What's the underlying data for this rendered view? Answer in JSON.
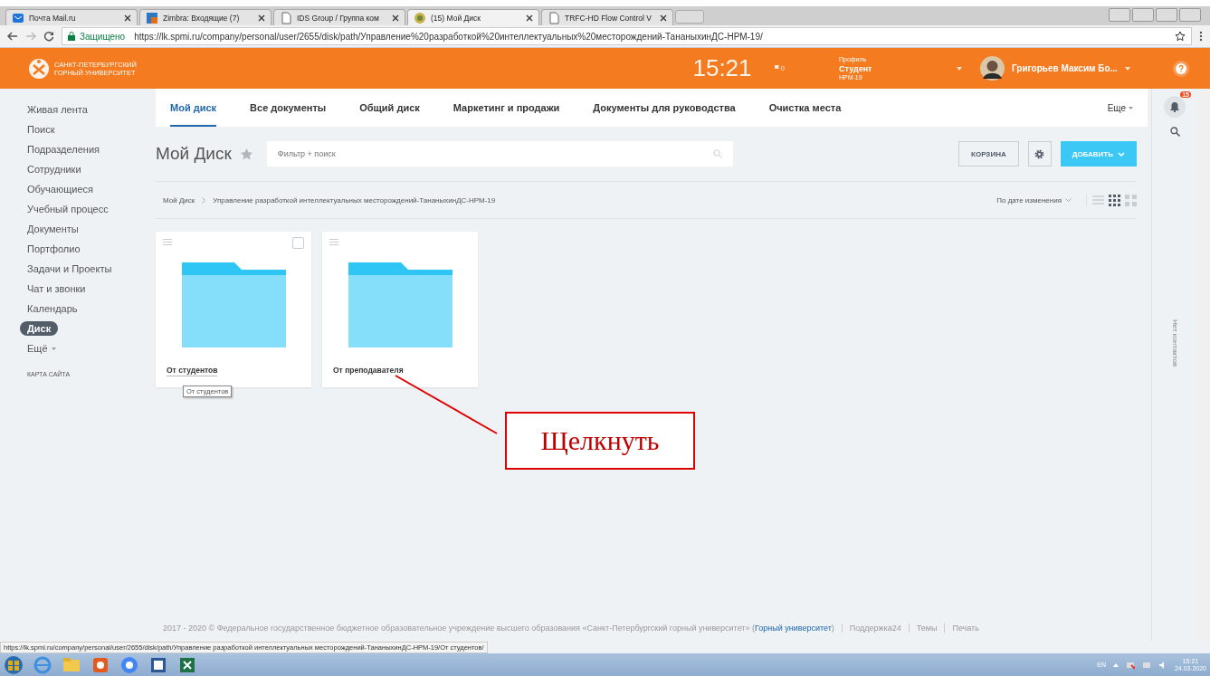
{
  "browser": {
    "tabs": [
      {
        "title": "Почта Mail.ru",
        "selected": false
      },
      {
        "title": "Zimbra: Входящие (7)",
        "selected": false
      },
      {
        "title": "IDS Group / Группа ком",
        "selected": false
      },
      {
        "title": "(15) Мой Диск",
        "selected": true
      },
      {
        "title": "TRFC-HD Flow Control V",
        "selected": false
      }
    ],
    "secure_label": "Защищено",
    "url": "https://lk.spmi.ru/company/personal/user/2655/disk/path/Управление%20разработкой%20интеллектуальных%20месторождений-ТананыхинДС-НРМ-19/"
  },
  "header": {
    "logo_lines": [
      "САНКТ-ПЕТЕРБУРГСКИЙ",
      "ГОРНЫЙ УНИВЕРСИТЕТ"
    ],
    "time": "15:21",
    "flag_count": "0",
    "profile_label": "Профиль",
    "role": "Студент",
    "group": "НРМ-19",
    "user_name": "Григорьев Максим Бо..."
  },
  "sidebar": {
    "items": [
      {
        "label": "Живая лента",
        "selected": false
      },
      {
        "label": "Поиск",
        "selected": false
      },
      {
        "label": "Подразделения",
        "selected": false
      },
      {
        "label": "Сотрудники",
        "selected": false
      },
      {
        "label": "Обучающиеся",
        "selected": false
      },
      {
        "label": "Учебный процесс",
        "selected": false
      },
      {
        "label": "Документы",
        "selected": false
      },
      {
        "label": "Портфолио",
        "selected": false
      },
      {
        "label": "Задачи и Проекты",
        "selected": false
      },
      {
        "label": "Чат и звонки",
        "selected": false
      },
      {
        "label": "Календарь",
        "selected": false
      },
      {
        "label": "Диск",
        "selected": true
      },
      {
        "label": "Ещё",
        "selected": false
      }
    ],
    "sitemap": "КАРТА САЙТА"
  },
  "nav": {
    "tabs": [
      {
        "label": "Мой диск",
        "selected": true
      },
      {
        "label": "Все документы",
        "selected": false
      },
      {
        "label": "Общий диск",
        "selected": false
      },
      {
        "label": "Маркетинг и продажи",
        "selected": false
      },
      {
        "label": "Документы для руководства",
        "selected": false
      },
      {
        "label": "Очистка места",
        "selected": false
      }
    ],
    "more": "Еще"
  },
  "toolbar": {
    "title": "Мой Диск",
    "search_placeholder": "Фильтр + поиск",
    "trash_button": "КОРЗИНА",
    "add_button": "ДОБАВИТЬ"
  },
  "breadcrumbs": [
    "Мой Диск",
    "Управление разработкой интеллектуальных месторождений-ТананыхинДС-НРМ-19"
  ],
  "sort": "По дате изменения",
  "views": [
    {
      "kind": "list",
      "selected": false
    },
    {
      "kind": "grid",
      "selected": true
    },
    {
      "kind": "tiles",
      "selected": false
    }
  ],
  "folders": [
    {
      "name": "От студентов",
      "hovered": true,
      "checked": false,
      "tooltip": "От студентов"
    },
    {
      "name": "От преподавателя",
      "hovered": false
    }
  ],
  "right_panel": {
    "notifications": "15",
    "contacts": "Нет контактов"
  },
  "footer": {
    "copyright": "2017 - 2020 © Федеральное государственное бюджетное образовательное учреждение высшего образования «Санкт-Петербургский горный университет» (",
    "link": "Горный университет",
    "copyright_end": ")",
    "links": [
      "Поддержка24",
      "Темы",
      "Печать"
    ]
  },
  "status_url": "https://lk.spmi.ru/company/personal/user/2655/disk/path/Управление разработкой интеллектуальных месторождений-ТананыхинДС-НРМ-19/От студентов/",
  "taskbar": {
    "language": "EN",
    "time": "15:21",
    "date": "24.03.2020"
  },
  "annotation": {
    "text": "Щелкнуть"
  }
}
